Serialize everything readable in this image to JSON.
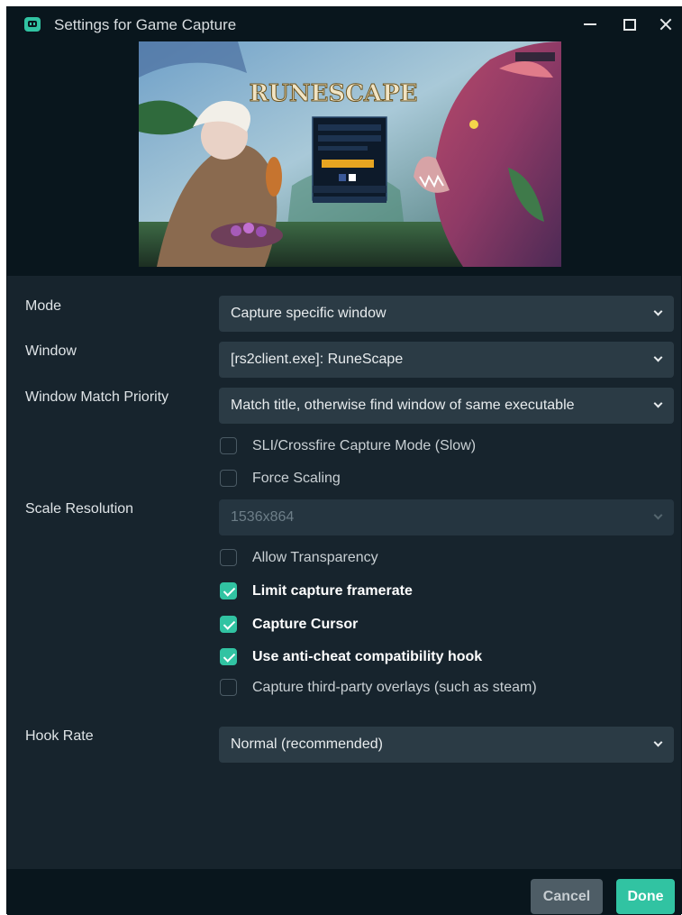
{
  "window": {
    "title": "Settings for Game Capture"
  },
  "preview": {
    "logo_text": "RUNESCAPE"
  },
  "form": {
    "mode": {
      "label": "Mode",
      "value": "Capture specific window"
    },
    "window_select": {
      "label": "Window",
      "value": "[rs2client.exe]: RuneScape"
    },
    "match_priority": {
      "label": "Window Match Priority",
      "value": "Match title, otherwise find window of same executable"
    },
    "scale_resolution": {
      "label": "Scale Resolution",
      "value": "1536x864",
      "disabled": true
    },
    "hook_rate": {
      "label": "Hook Rate",
      "value": "Normal (recommended)"
    },
    "checkboxes": [
      {
        "label": "SLI/Crossfire Capture Mode (Slow)",
        "checked": false
      },
      {
        "label": "Force Scaling",
        "checked": false
      },
      {
        "label": "Allow Transparency",
        "checked": false
      },
      {
        "label": "Limit capture framerate",
        "checked": true
      },
      {
        "label": "Capture Cursor",
        "checked": true
      },
      {
        "label": "Use anti-cheat compatibility hook",
        "checked": true
      },
      {
        "label": "Capture third-party overlays (such as steam)",
        "checked": false
      }
    ]
  },
  "footer": {
    "cancel_label": "Cancel",
    "done_label": "Done"
  },
  "colors": {
    "accent": "#31c3a2",
    "background": "#17242d",
    "titlebar": "#09161d",
    "input": "#2b3b45"
  },
  "icons": {
    "app": "streamlabs-app-icon",
    "minimize": "minimize-icon",
    "maximize": "maximize-icon",
    "close": "close-icon",
    "dropdown": "chevron-down-icon",
    "check": "checkmark-icon"
  }
}
